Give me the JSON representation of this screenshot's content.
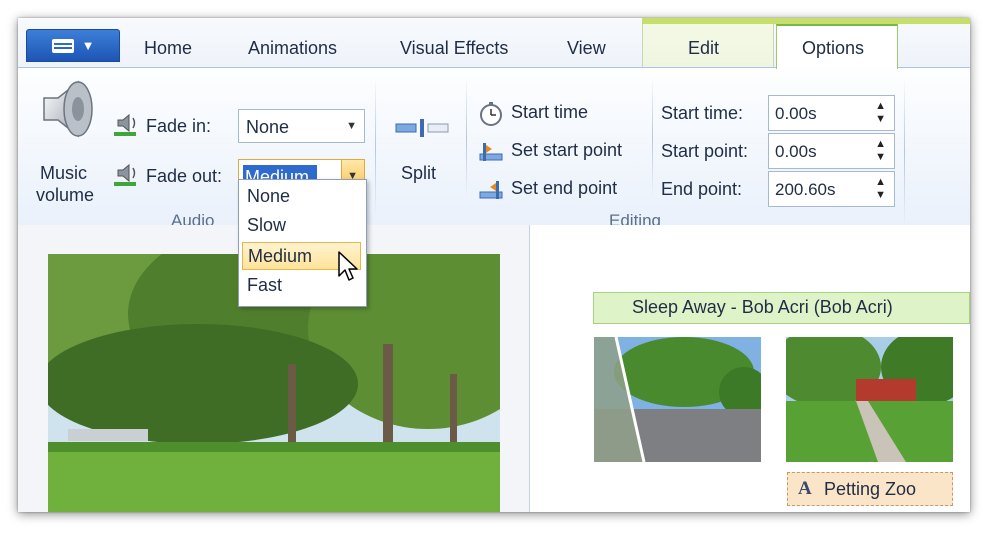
{
  "tabs": [
    "Home",
    "Animations",
    "Visual Effects",
    "View",
    "Edit",
    "Options"
  ],
  "active_tab": "Options",
  "audio_group": {
    "label": "Audio",
    "music_volume_label": [
      "Music",
      "volume"
    ],
    "fade_in_label": "Fade in:",
    "fade_in_value": "None",
    "fade_out_label": "Fade out:",
    "fade_out_value": "Medium"
  },
  "split_label": "Split",
  "editing_group": {
    "label": "Editing",
    "start_time_button": "Start time",
    "set_start_point_button": "Set start point",
    "set_end_point_button": "Set end point",
    "start_time_label": "Start time:",
    "start_time_value": "0.00s",
    "start_point_label": "Start point:",
    "start_point_value": "0.00s",
    "end_point_label": "End point:",
    "end_point_value": "200.60s"
  },
  "fade_out_options": [
    "None",
    "Slow",
    "Medium",
    "Fast"
  ],
  "selected_option": "Medium",
  "storyboard": {
    "audio_caption": "Sleep Away - Bob Acri (Bob Acri)",
    "title_caption": "Petting Zoo"
  },
  "icons": {
    "app_menu": "menu-icon",
    "music_volume": "speaker-icon",
    "fade": "small-speaker-icon",
    "split": "split-icon",
    "start_time": "stopwatch-icon",
    "set_start_point": "set-start-point-icon",
    "set_end_point": "set-end-point-icon",
    "caption": "text-A-icon",
    "cursor": "mouse-cursor-icon"
  },
  "colors": {
    "accent_blue": "#1d55b5",
    "context_green": "#c6df6a",
    "selection_highlight": "#ffe39a",
    "audio_bar": "#dff3c8"
  }
}
